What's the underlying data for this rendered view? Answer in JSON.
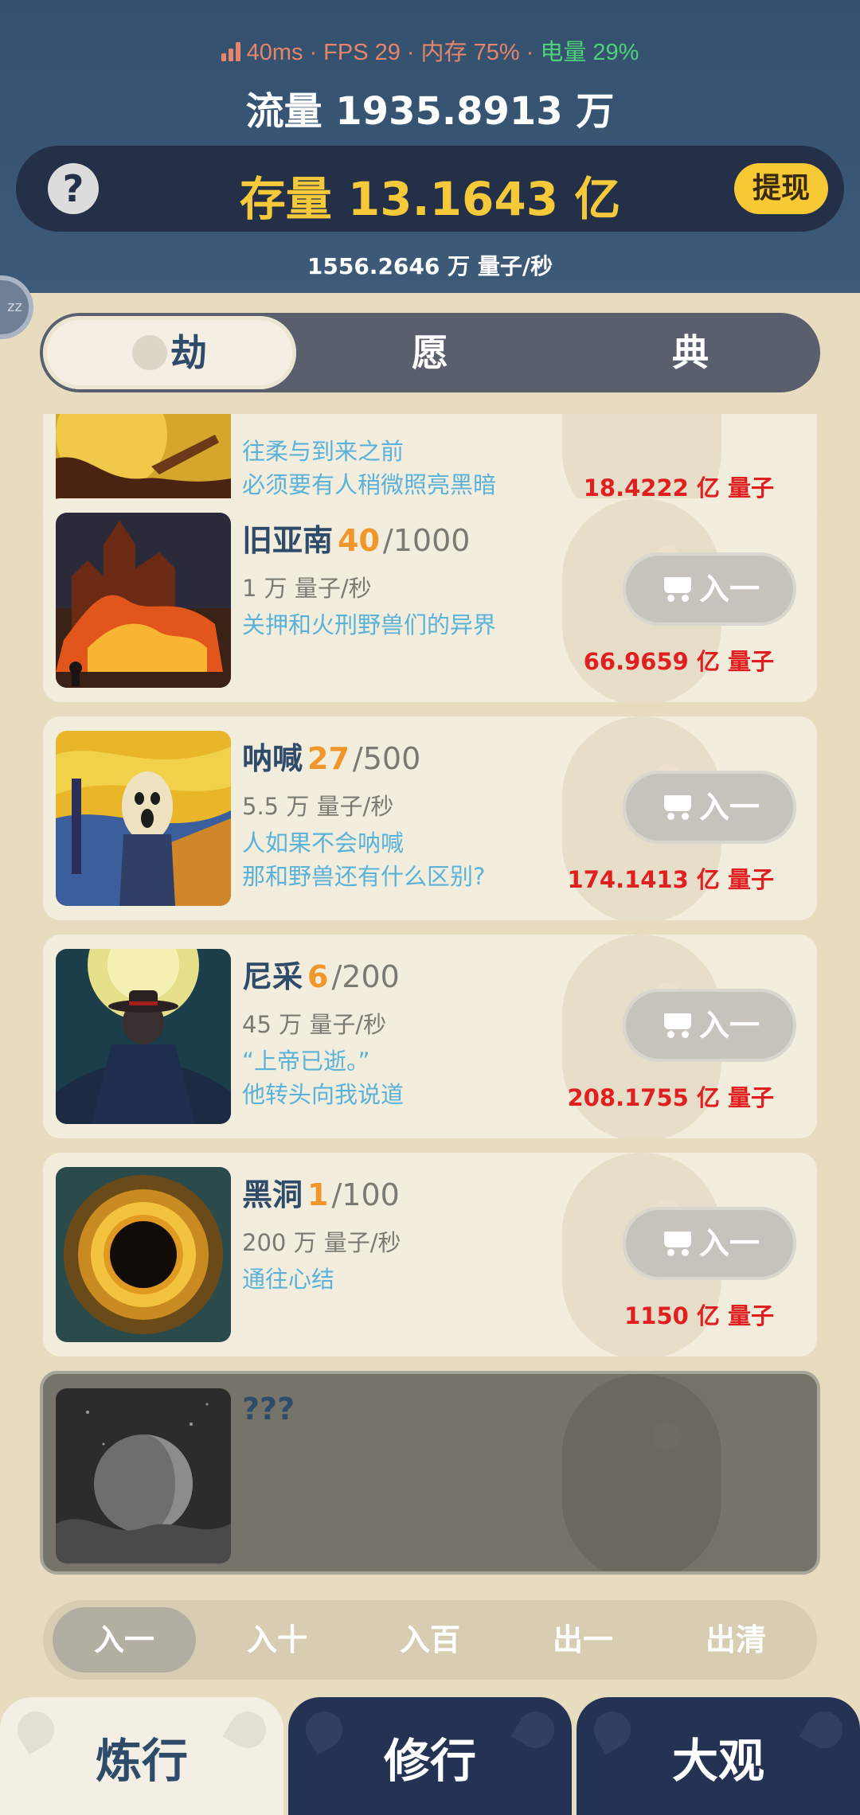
{
  "status": {
    "latency": "40ms",
    "fps": "FPS 29",
    "memory": "内存 75%",
    "battery": "电量 29%",
    "separator": "·",
    "colors": {
      "latency": "#e6856b",
      "battery": "#4fd07a"
    }
  },
  "header": {
    "flow": "流量 1935.8913 万",
    "stock": "存量 13.1643 亿",
    "help_label": "?",
    "withdraw_label": "提现",
    "rate": "1556.2646 万   量子/秒",
    "side_bubble_label": "zz"
  },
  "tabs": [
    {
      "label": "劫",
      "active": true
    },
    {
      "label": "愿",
      "active": false
    },
    {
      "label": "典",
      "active": false
    }
  ],
  "items": [
    {
      "name": "",
      "count": "",
      "max": "",
      "production": "",
      "desc_lines": [
        "往柔与到来之前",
        "必须要有人稍微照亮黑暗"
      ],
      "price": "18.4222 亿 量子",
      "buy_label": ""
    },
    {
      "name": "旧亚南",
      "count": "40",
      "max": "/1000",
      "production": "1 万 量子/秒",
      "desc_lines": [
        "关押和火刑野兽们的异界",
        ""
      ],
      "price": "66.9659 亿 量子",
      "buy_label": "入一"
    },
    {
      "name": "呐喊",
      "count": "27",
      "max": "/500",
      "production": "5.5 万 量子/秒",
      "desc_lines": [
        "人如果不会呐喊",
        "那和野兽还有什么区别?"
      ],
      "price": "174.1413 亿 量子",
      "buy_label": "入一"
    },
    {
      "name": "尼采",
      "count": "6",
      "max": "/200",
      "production": "45 万 量子/秒",
      "desc_lines": [
        "“上帝已逝。”",
        "他转头向我说道"
      ],
      "price": "208.1755 亿 量子",
      "buy_label": "入一"
    },
    {
      "name": "黑洞",
      "count": "1",
      "max": "/100",
      "production": "200 万 量子/秒",
      "desc_lines": [
        "通往心结",
        ""
      ],
      "price": "1150 亿 量子",
      "buy_label": "入一"
    },
    {
      "name": "???",
      "locked": true
    }
  ],
  "quantity": [
    {
      "label": "入一",
      "active": true
    },
    {
      "label": "入十",
      "active": false
    },
    {
      "label": "入百",
      "active": false
    },
    {
      "label": "出一",
      "active": false
    },
    {
      "label": "出清",
      "active": false
    }
  ],
  "nav": [
    {
      "label": "炼行",
      "active": true
    },
    {
      "label": "修行",
      "active": false
    },
    {
      "label": "大观",
      "active": false
    }
  ],
  "icons": {
    "signal": "signal-bars-icon",
    "help": "question-icon",
    "cart": "shopping-cart-icon"
  }
}
